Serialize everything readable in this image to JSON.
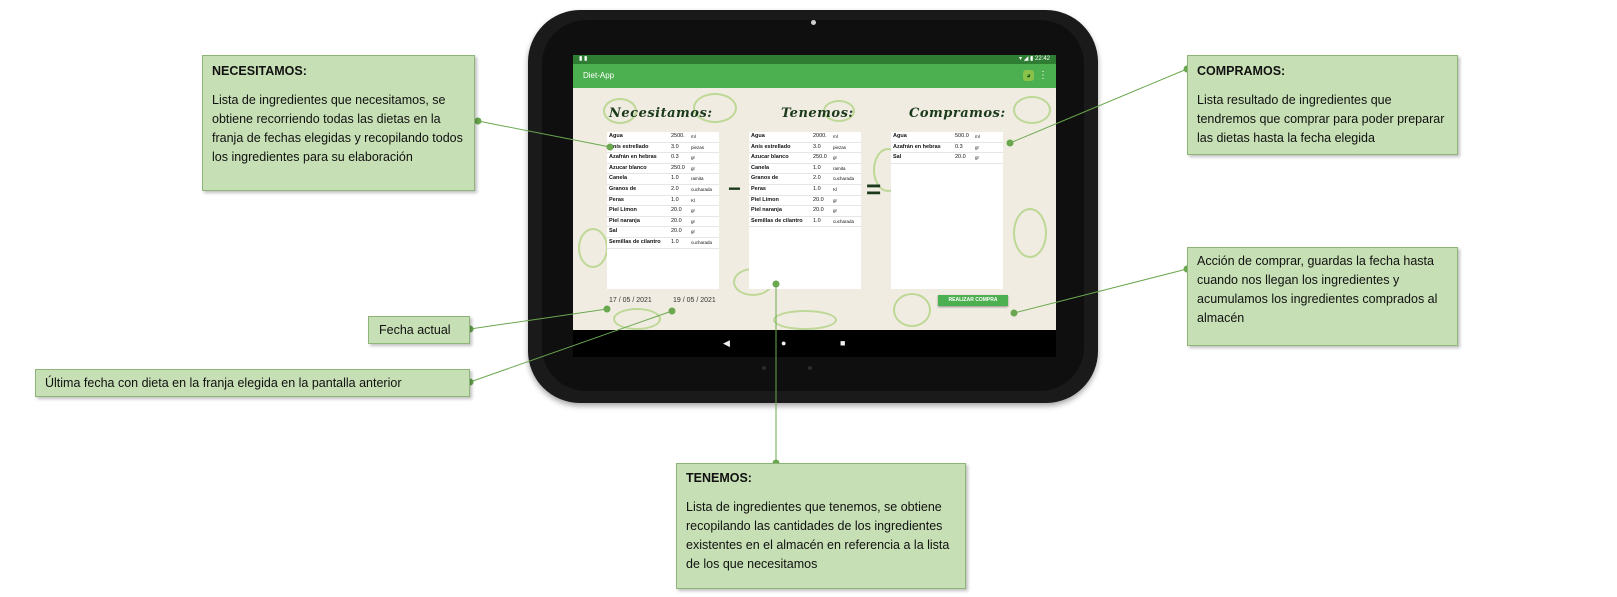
{
  "device": {
    "status_left": "▮ ▮",
    "status_right": "▾ ◢ ▮ 22:42",
    "nav_back": "◀",
    "nav_home": "●",
    "nav_recent": "■"
  },
  "app": {
    "title": "Diet-App",
    "menu_icon": "⋮",
    "android_icon": "◕"
  },
  "columns": {
    "necesitamos_title": "Necesitamos:",
    "tenemos_title": "Tenemos:",
    "compramos_title": "Compramos:",
    "minus": "−",
    "equals": "="
  },
  "necesitamos": [
    {
      "name": "Agua",
      "qty": "2500.",
      "unit": "ml"
    },
    {
      "name": "Anís estrellado",
      "qty": "3.0",
      "unit": "piezas"
    },
    {
      "name": "Azafrán en hebras",
      "qty": "0.3",
      "unit": "gr"
    },
    {
      "name": "Azucar blanco",
      "qty": "250.0",
      "unit": "gr"
    },
    {
      "name": "Canela",
      "qty": "1.0",
      "unit": "ramita"
    },
    {
      "name": "Granos de",
      "qty": "2.0",
      "unit": "cucharada"
    },
    {
      "name": "Peras",
      "qty": "1.0",
      "unit": "Kl"
    },
    {
      "name": "Piel Limon",
      "qty": "20.0",
      "unit": "gr"
    },
    {
      "name": "Piel naranja",
      "qty": "20.0",
      "unit": "gr"
    },
    {
      "name": "Sal",
      "qty": "20.0",
      "unit": "gr"
    },
    {
      "name": "Semillas de cilantro",
      "qty": "1.0",
      "unit": "cucharada"
    }
  ],
  "tenemos": [
    {
      "name": "Agua",
      "qty": "2000.",
      "unit": "ml"
    },
    {
      "name": "Anís estrellado",
      "qty": "3.0",
      "unit": "piezas"
    },
    {
      "name": "Azucar blanco",
      "qty": "250.0",
      "unit": "gr"
    },
    {
      "name": "Canela",
      "qty": "1.0",
      "unit": "ramita"
    },
    {
      "name": "Granos de",
      "qty": "2.0",
      "unit": "cucharada"
    },
    {
      "name": "Peras",
      "qty": "1.0",
      "unit": "Kl"
    },
    {
      "name": "Piel Limon",
      "qty": "20.0",
      "unit": "gr"
    },
    {
      "name": "Piel naranja",
      "qty": "20.0",
      "unit": "gr"
    },
    {
      "name": "Semillas de cilantro",
      "qty": "1.0",
      "unit": "cucharada"
    }
  ],
  "compramos": [
    {
      "name": "Agua",
      "qty": "500.0",
      "unit": "ml"
    },
    {
      "name": "Azafrán en hebras",
      "qty": "0.3",
      "unit": "gr"
    },
    {
      "name": "Sal",
      "qty": "20.0",
      "unit": "gr"
    }
  ],
  "dates": {
    "current": "17 / 05 / 2021",
    "last": "19 / 05 / 2021"
  },
  "buy_button": "REALIZAR COMPRA",
  "callouts": {
    "necesitamos": {
      "head": "NECESITAMOS:",
      "body": "Lista de ingredientes que necesitamos, se obtiene recorriendo todas las dietas en la franja de fechas elegidas y recopilando todos los ingredientes para su elaboración"
    },
    "compramos": {
      "head": "COMPRAMOS:",
      "body": "Lista resultado de ingredientes que tendremos que comprar para poder preparar las dietas hasta la fecha elegida"
    },
    "accion": {
      "body": "Acción de comprar, guardas la fecha hasta cuando nos llegan los ingredientes y acumulamos los ingredientes comprados al almacén"
    },
    "fecha_actual": {
      "body": "Fecha actual"
    },
    "ultima_fecha": {
      "body": "Última fecha con dieta en la franja elegida en la pantalla anterior"
    },
    "tenemos": {
      "head": "TENEMOS:",
      "body": "Lista de ingredientes que tenemos, se obtiene recopilando las cantidades de los ingredientes existentes en el almacén en referencia a la lista de los que necesitamos"
    }
  },
  "colors": {
    "app_green": "#4caf50",
    "status_green": "#2e7d32",
    "callout_bg": "#c6dfb4",
    "connector": "#6aa84f"
  }
}
